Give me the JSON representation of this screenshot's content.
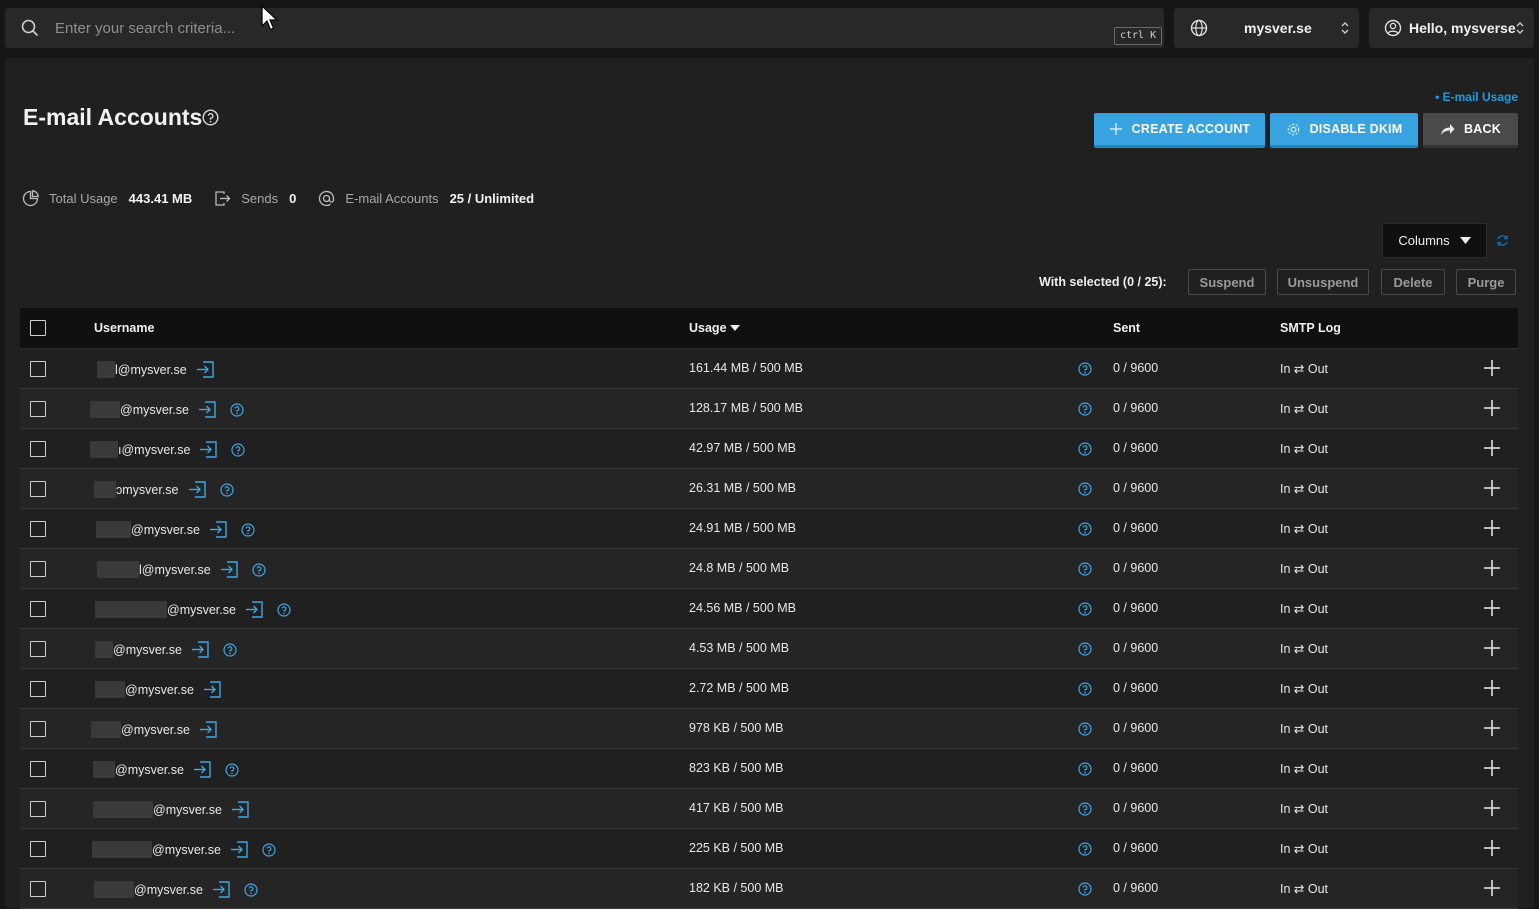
{
  "search": {
    "placeholder": "Enter your search criteria...",
    "shortcut": "ctrl K"
  },
  "domain_selector": {
    "value": "mysver.se"
  },
  "user_menu": {
    "label": "Hello, mysverse"
  },
  "page": {
    "title": "E-mail Accounts",
    "usage_link": "• E-mail Usage",
    "buttons": {
      "create": "CREATE ACCOUNT",
      "dkim": "DISABLE DKIM",
      "back": "BACK"
    }
  },
  "stats": {
    "total_usage_label": "Total Usage",
    "total_usage_value": "443.41 MB",
    "sends_label": "Sends",
    "sends_value": "0",
    "accounts_label": "E-mail Accounts",
    "accounts_value": "25 / Unlimited"
  },
  "toolbar": {
    "columns_label": "Columns",
    "with_selected": "With selected (0 / 25):",
    "actions": [
      "Suspend",
      "Unsuspend",
      "Delete",
      "Purge"
    ]
  },
  "table": {
    "headers": {
      "username": "Username",
      "usage": "Usage",
      "sent": "Sent",
      "smtp": "SMTP Log"
    },
    "rows": [
      {
        "user": "l@mysver.se",
        "usage": "161.44 MB / 500 MB",
        "sent": "0 / 9600",
        "smtp": "In ⇄ Out"
      },
      {
        "user": "@mysver.se",
        "usage": "128.17 MB / 500 MB",
        "sent": "0 / 9600",
        "smtp": "In ⇄ Out"
      },
      {
        "user": "ı@mysver.se",
        "usage": "42.97 MB / 500 MB",
        "sent": "0 / 9600",
        "smtp": "In ⇄ Out"
      },
      {
        "user": "ɔmysver.se",
        "usage": "26.31 MB / 500 MB",
        "sent": "0 / 9600",
        "smtp": "In ⇄ Out"
      },
      {
        "user": "@mysver.se",
        "usage": "24.91 MB / 500 MB",
        "sent": "0 / 9600",
        "smtp": "In ⇄ Out"
      },
      {
        "user": "l@mysver.se",
        "usage": "24.8 MB / 500 MB",
        "sent": "0 / 9600",
        "smtp": "In ⇄ Out"
      },
      {
        "user": "@mysver.se",
        "usage": "24.56 MB / 500 MB",
        "sent": "0 / 9600",
        "smtp": "In ⇄ Out"
      },
      {
        "user": "@mysver.se",
        "usage": "4.53 MB / 500 MB",
        "sent": "0 / 9600",
        "smtp": "In ⇄ Out"
      },
      {
        "user": "@mysver.se",
        "usage": "2.72 MB / 500 MB",
        "sent": "0 / 9600",
        "smtp": "In ⇄ Out"
      },
      {
        "user": "@mysver.se",
        "usage": "978 KB / 500 MB",
        "sent": "0 / 9600",
        "smtp": "In ⇄ Out"
      },
      {
        "user": "@mysver.se",
        "usage": "823 KB / 500 MB",
        "sent": "0 / 9600",
        "smtp": "In ⇄ Out"
      },
      {
        "user": "@mysver.se",
        "usage": "417 KB / 500 MB",
        "sent": "0 / 9600",
        "smtp": "In ⇄ Out"
      },
      {
        "user": "@mysver.se",
        "usage": "225 KB / 500 MB",
        "sent": "0 / 9600",
        "smtp": "In ⇄ Out"
      },
      {
        "user": "@mysver.se",
        "usage": "182 KB / 500 MB",
        "sent": "0 / 9600",
        "smtp": "In ⇄ Out"
      }
    ]
  },
  "colors": {
    "accent": "#37a3e0",
    "link": "#1e9be0",
    "background": "#202020"
  }
}
